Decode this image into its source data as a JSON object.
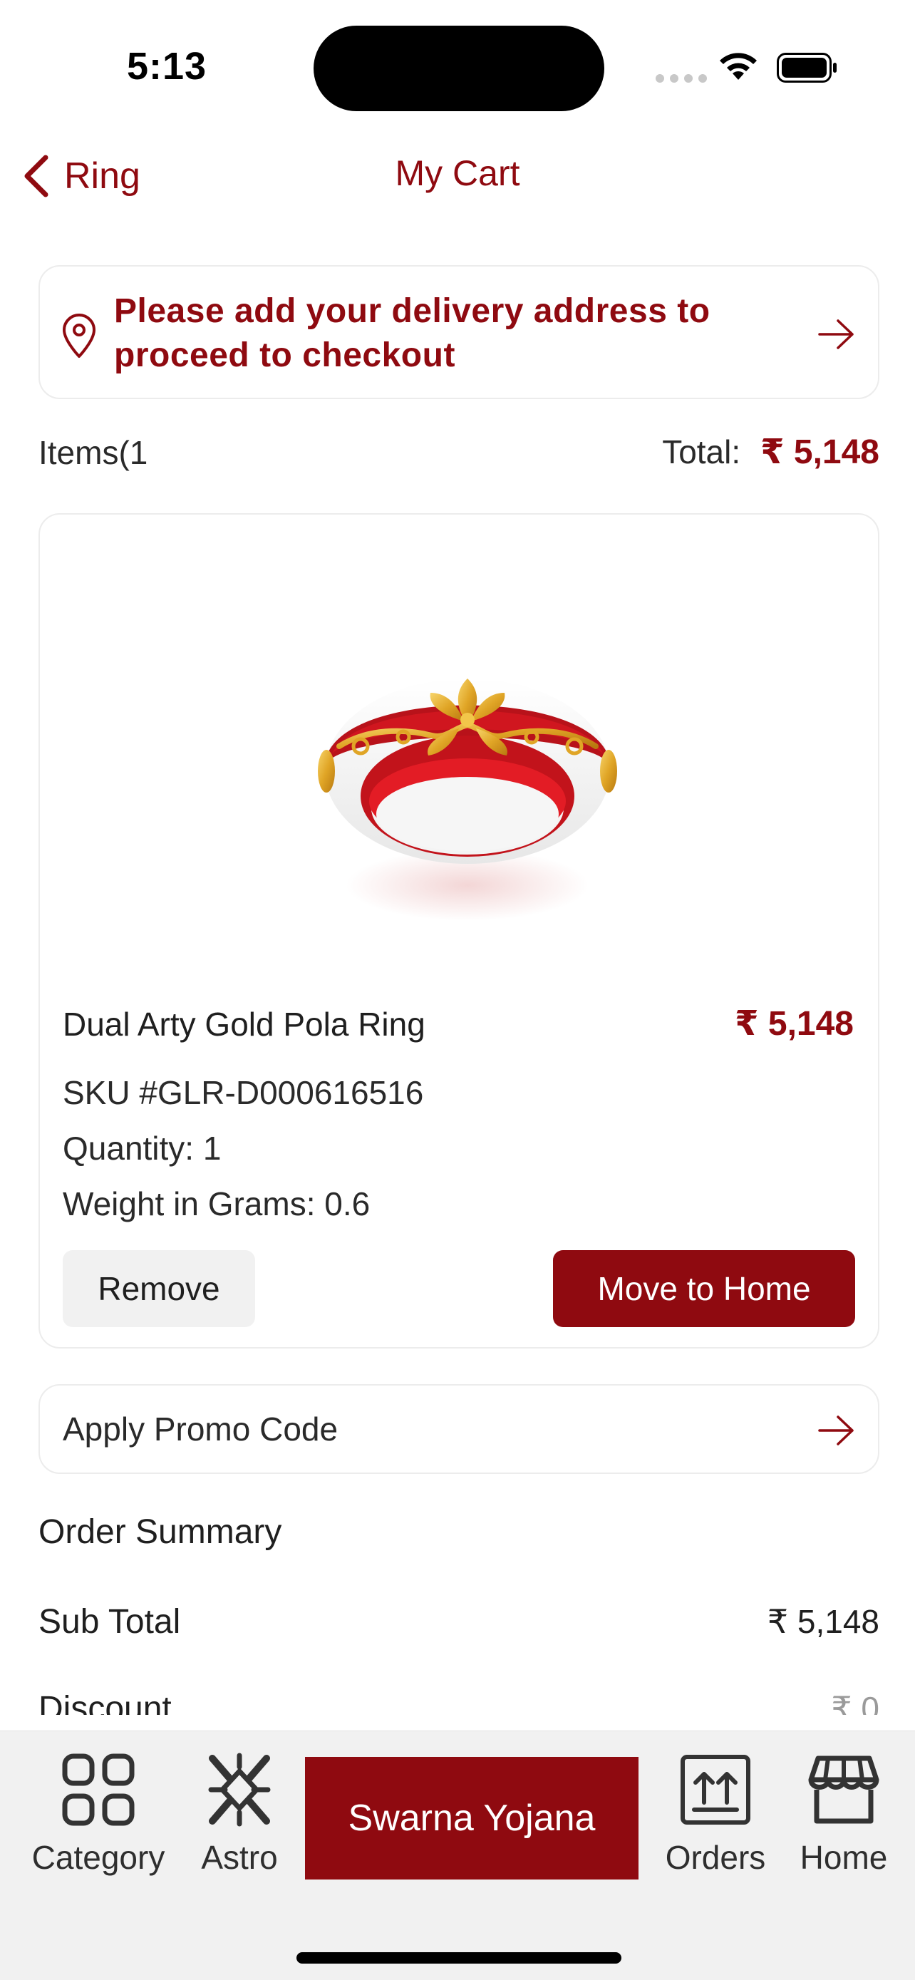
{
  "status_bar": {
    "time": "5:13"
  },
  "nav": {
    "back_label": "Ring",
    "title": "My Cart"
  },
  "address_notice": {
    "text": "Please add your delivery address to proceed to checkout"
  },
  "cart_header": {
    "items_label": "Items(1",
    "total_label": "Total:",
    "total_value": "₹ 5,148"
  },
  "product": {
    "name": "Dual Arty Gold Pola Ring",
    "price": "₹ 5,148",
    "sku": "SKU #GLR-D000616516",
    "quantity": "Quantity: 1",
    "weight": "Weight in Grams: 0.6",
    "remove_label": "Remove",
    "move_label": "Move to Home"
  },
  "promo": {
    "label": "Apply Promo Code"
  },
  "order_summary": {
    "title": "Order Summary",
    "rows": [
      {
        "label": "Sub Total",
        "value": "₹ 5,148"
      },
      {
        "label": "Discount",
        "value": "₹ 0"
      }
    ]
  },
  "tab_bar": {
    "category": "Category",
    "astro": "Astro",
    "swarna": "Swarna Yojana",
    "orders": "Orders",
    "home": "Home"
  },
  "colors": {
    "accent": "#8f0a10",
    "card_border": "#ececec",
    "tab_bg": "#f1f1f1"
  }
}
